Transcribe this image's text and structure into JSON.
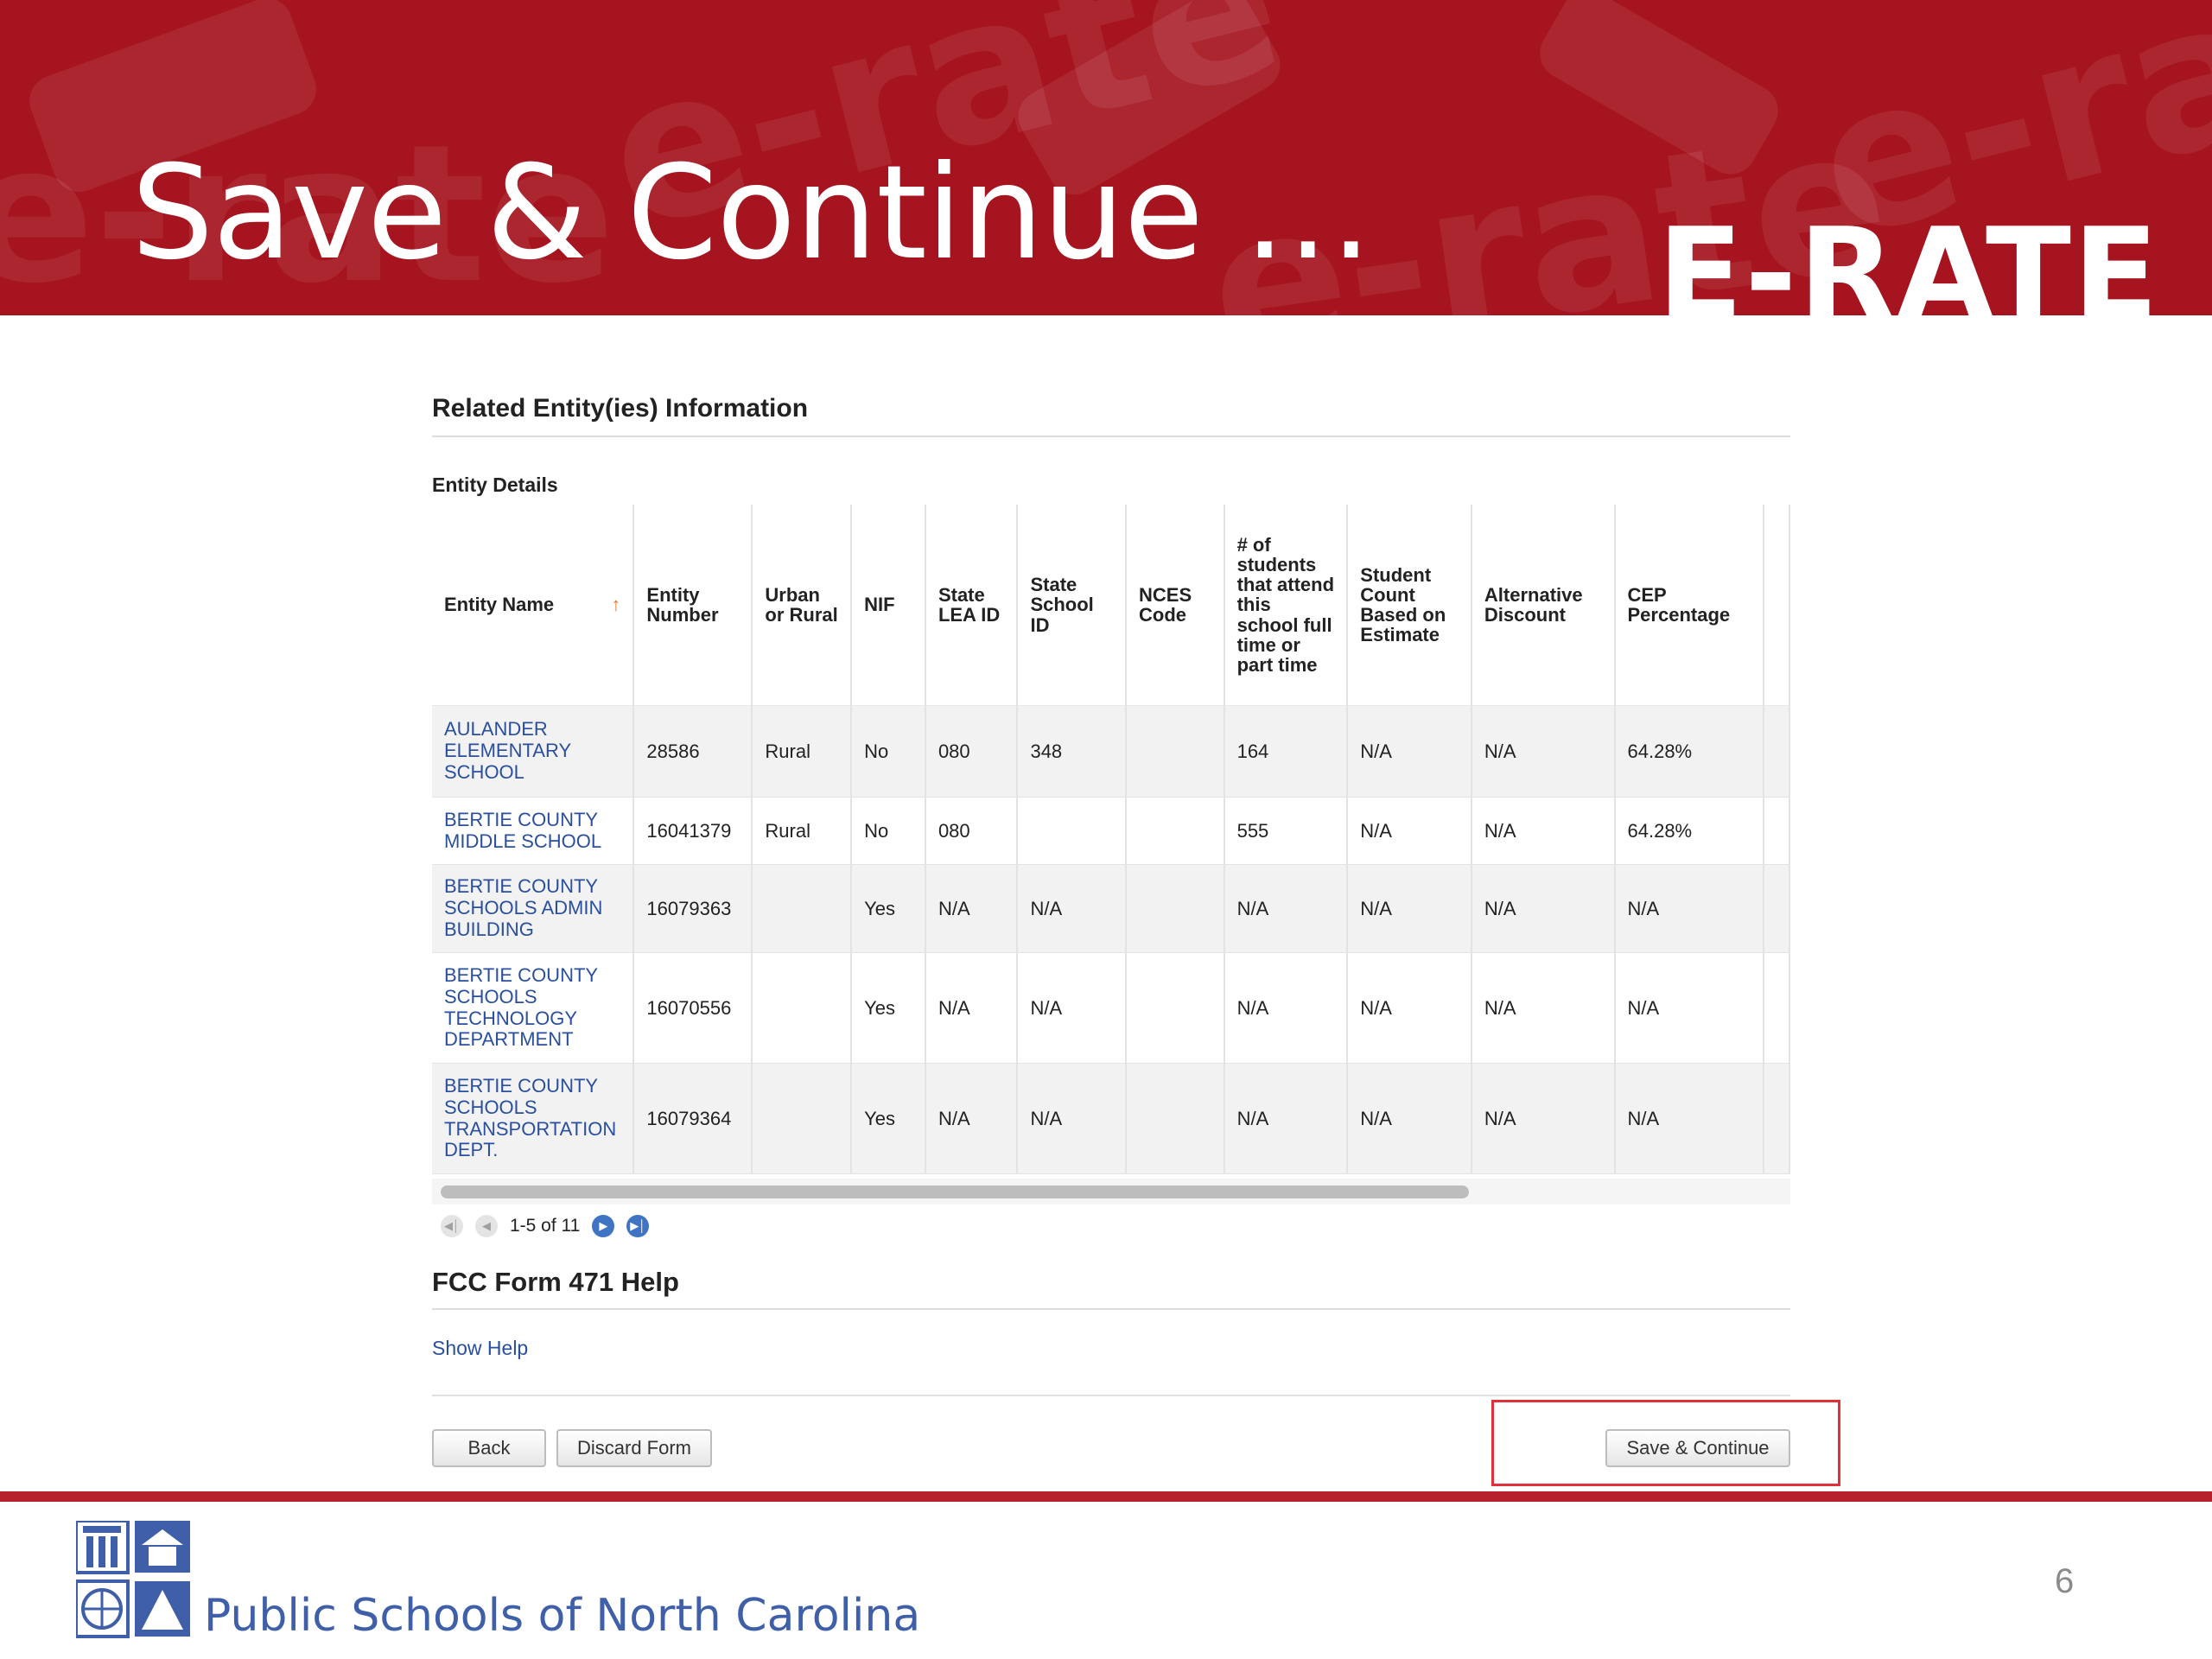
{
  "banner": {
    "title": "Save & Continue …",
    "brand": "E-RATE",
    "watermark": "e-rate",
    "colors": {
      "background": "#a5141f",
      "text": "#ffffff"
    }
  },
  "form": {
    "section_title": "Related Entity(ies) Information",
    "subsection_title": "Entity Details",
    "table": {
      "columns": [
        "Entity Name",
        "Entity Number",
        "Urban or Rural",
        "NIF",
        "State LEA ID",
        "State School ID",
        "NCES Code",
        "# of students that attend this school full time or part time",
        "Student Count Based on Estimate",
        "Alternative Discount",
        "CEP Percentage"
      ],
      "sort_indicator": "↑",
      "rows": [
        [
          "AULANDER ELEMENTARY SCHOOL",
          "28586",
          "Rural",
          "No",
          "080",
          "348",
          "",
          "164",
          "N/A",
          "N/A",
          "64.28%"
        ],
        [
          "BERTIE COUNTY MIDDLE SCHOOL",
          "16041379",
          "Rural",
          "No",
          "080",
          "",
          "",
          "555",
          "N/A",
          "N/A",
          "64.28%"
        ],
        [
          "BERTIE COUNTY SCHOOLS ADMIN BUILDING",
          "16079363",
          "",
          "Yes",
          "N/A",
          "N/A",
          "",
          "N/A",
          "N/A",
          "N/A",
          "N/A"
        ],
        [
          "BERTIE COUNTY SCHOOLS TECHNOLOGY DEPARTMENT",
          "16070556",
          "",
          "Yes",
          "N/A",
          "N/A",
          "",
          "N/A",
          "N/A",
          "N/A",
          "N/A"
        ],
        [
          "BERTIE COUNTY SCHOOLS TRANSPORTATION DEPT.",
          "16079364",
          "",
          "Yes",
          "N/A",
          "N/A",
          "",
          "N/A",
          "N/A",
          "N/A",
          "N/A"
        ]
      ]
    },
    "pagination": {
      "label": "1-5 of 11",
      "icons": [
        "first-page-icon",
        "prev-page-icon",
        "next-page-icon",
        "last-page-icon"
      ]
    },
    "help_title": "FCC Form 471 Help",
    "show_help_link": "Show Help",
    "buttons": {
      "back": "Back",
      "discard": "Discard Form",
      "save_continue": "Save & Continue"
    },
    "colors": {
      "link": "#2a4f9e",
      "highlight": "#e0303a"
    }
  },
  "footer": {
    "org_name": "Public Schools of North Carolina",
    "page_number": "6",
    "colors": {
      "rule": "#b5202b",
      "text": "#3f5fa8"
    }
  }
}
